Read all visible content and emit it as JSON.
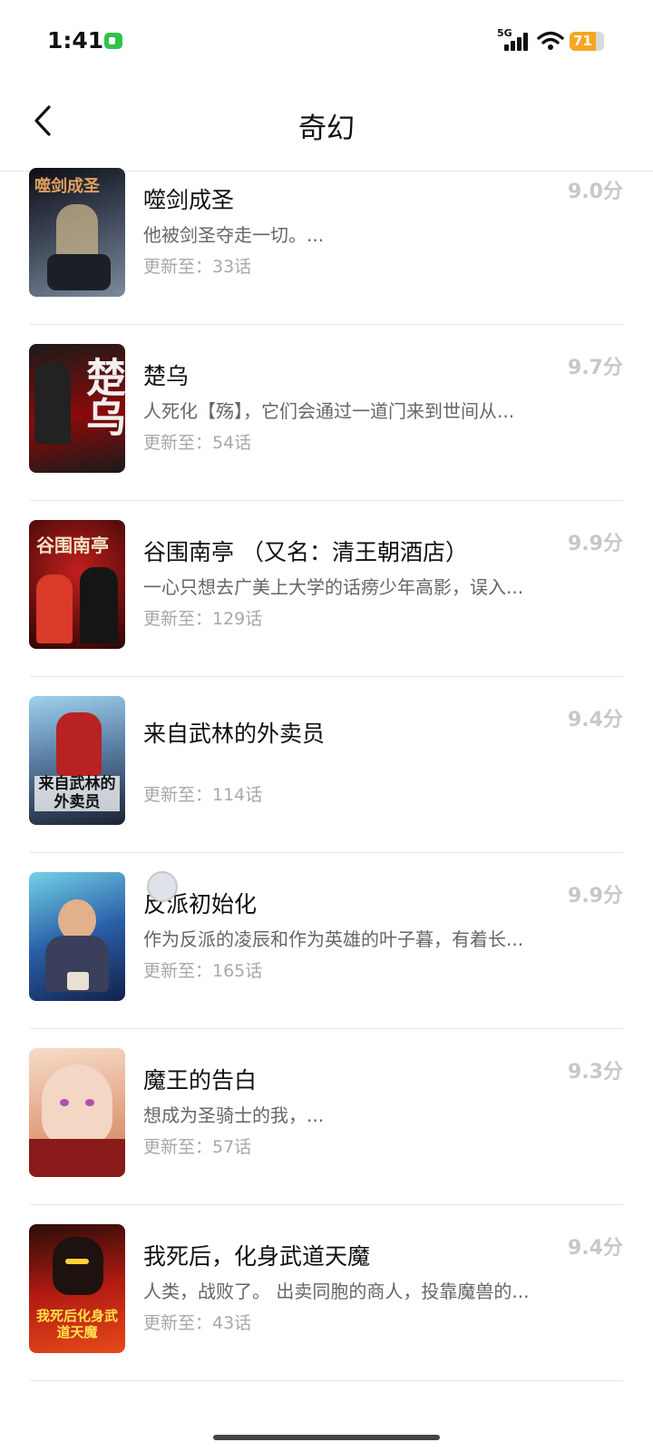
{
  "status": {
    "time": "1:41",
    "network": "5G",
    "battery": "71"
  },
  "nav": {
    "title": "奇幻"
  },
  "items": [
    {
      "title": "噬剑成圣",
      "desc": "他被剑圣夺走一切。...",
      "update": "更新至：33话",
      "score": "9.0分",
      "cover_colors": [
        "#0c0e14",
        "#7c8a9c"
      ],
      "cover_text": "噬剑成圣"
    },
    {
      "title": "楚乌",
      "desc": "人死化【殇】，它们会通过一道门来到世间从...",
      "update": "更新至：54话",
      "score": "9.7分",
      "cover_colors": [
        "#8b0a0a",
        "#1a1a1a"
      ],
      "cover_text": "楚乌"
    },
    {
      "title": "谷围南亭 （又名：清王朝酒店）",
      "desc": "一心只想去广美上大学的话痨少年高影，误入...",
      "update": "更新至：129话",
      "score": "9.9分",
      "cover_colors": [
        "#5a0c0c",
        "#c21f1f"
      ],
      "cover_text": "谷围南亭"
    },
    {
      "title": "来自武林的外卖员",
      "desc": "",
      "update": "更新至：114话",
      "score": "9.4分",
      "cover_colors": [
        "#9fd1ec",
        "#1c2433"
      ],
      "cover_text": "来自武林的外卖员"
    },
    {
      "title": "反派初始化",
      "desc": "作为反派的凌辰和作为英雄的叶子暮，有着长...",
      "update": "更新至：165话",
      "score": "9.9分",
      "cover_colors": [
        "#2a5ea8",
        "#73d2e6"
      ],
      "cover_text": ""
    },
    {
      "title": "魔王的告白",
      "desc": "想成为圣骑士的我，...",
      "update": "更新至：57话",
      "score": "9.3分",
      "cover_colors": [
        "#f6dcc8",
        "#c97a55"
      ],
      "cover_text": ""
    },
    {
      "title": "我死后，化身武道天魔",
      "desc": "人类，战败了。 出卖同胞的商人，投靠魔兽的...",
      "update": "更新至：43话",
      "score": "9.4分",
      "cover_colors": [
        "#b21a12",
        "#2a0c08"
      ],
      "cover_text": "我死后化身武道天魔"
    }
  ]
}
